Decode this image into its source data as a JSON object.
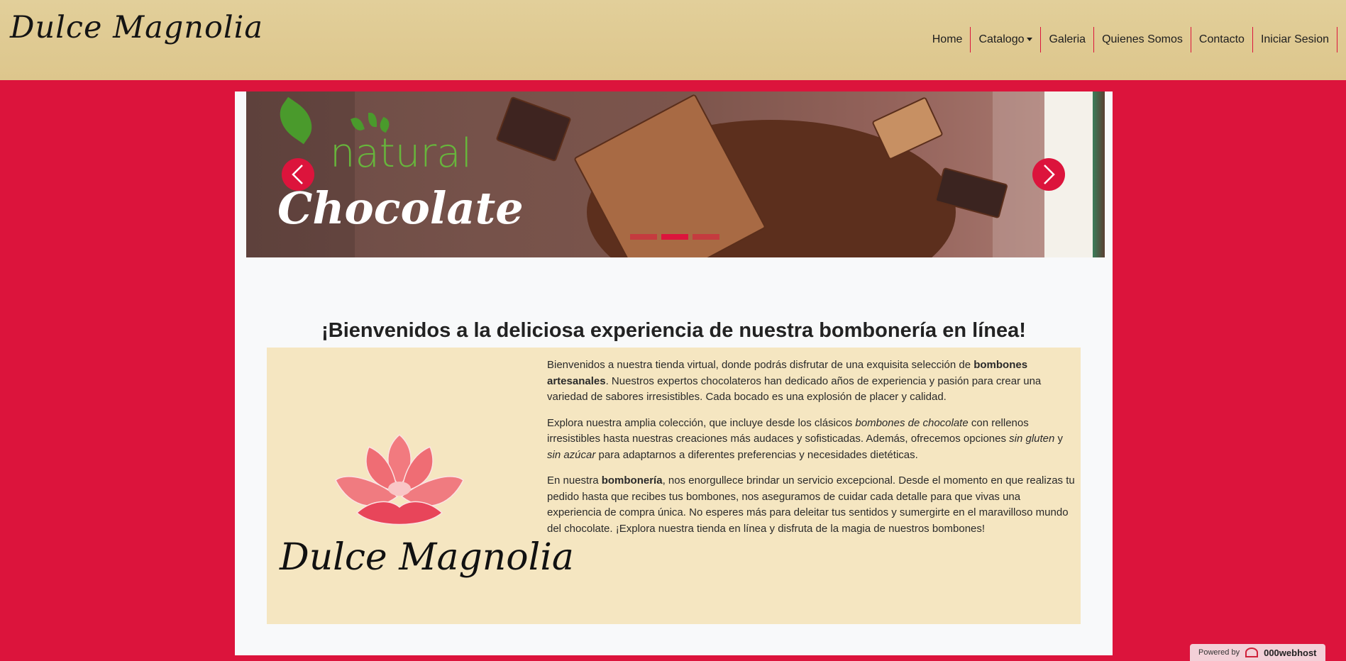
{
  "brand": {
    "name": "Dulce Magnolia"
  },
  "nav": {
    "items": [
      {
        "label": "Home"
      },
      {
        "label": "Catalogo"
      },
      {
        "label": "Galeria"
      },
      {
        "label": "Quienes Somos"
      },
      {
        "label": "Contacto"
      },
      {
        "label": "Iniciar Sesion"
      }
    ]
  },
  "carousel": {
    "slide_title_line1": "natural",
    "slide_title_line2": "Chocolate",
    "prev_icon": "chevron-left-icon",
    "next_icon": "chevron-right-icon",
    "indicator_count": 3,
    "active_indicator": 2
  },
  "welcome": {
    "title": "¡Bienvenidos a la deliciosa experiencia de nuestra bombonería en línea!"
  },
  "feature": {
    "logo_text": "Dulce Magnolia",
    "p1": {
      "a": "Bienvenidos a nuestra tienda virtual, donde podrás disfrutar de una exquisita selección de ",
      "b": "bombones artesanales",
      "c": ". Nuestros expertos chocolateros han dedicado años de experiencia y pasión para crear una variedad de sabores irresistibles. Cada bocado es una explosión de placer y calidad."
    },
    "p2": {
      "a": "Explora nuestra amplia colección, que incluye desde los clásicos ",
      "b": "bombones de chocolate",
      "c": " con rellenos irresistibles hasta nuestras creaciones más audaces y sofisticadas. Además, ofrecemos opciones ",
      "d": "sin gluten",
      "e": " y ",
      "f": "sin azúcar",
      "g": " para adaptarnos a diferentes preferencias y necesidades dietéticas."
    },
    "p3": {
      "a": "En nuestra ",
      "b": "bombonería",
      "c": ", nos enorgullece brindar un servicio excepcional. Desde el momento en que realizas tu pedido hasta que recibes tus bombones, nos aseguramos de cuidar cada detalle para que vivas una experiencia de compra única. No esperes más para deleitar tus sentidos y sumergirte en el maravilloso mundo del chocolate. ¡Explora nuestra tienda en línea y disfruta de la magia de nuestros bombones!"
    }
  },
  "footer_badge": {
    "prefix": "Powered by",
    "brand": "000webhost"
  },
  "colors": {
    "background": "#dc143c",
    "navbar": "#e0cb93",
    "feature_box": "#f5e6c1",
    "panel": "#f8f9fa"
  }
}
